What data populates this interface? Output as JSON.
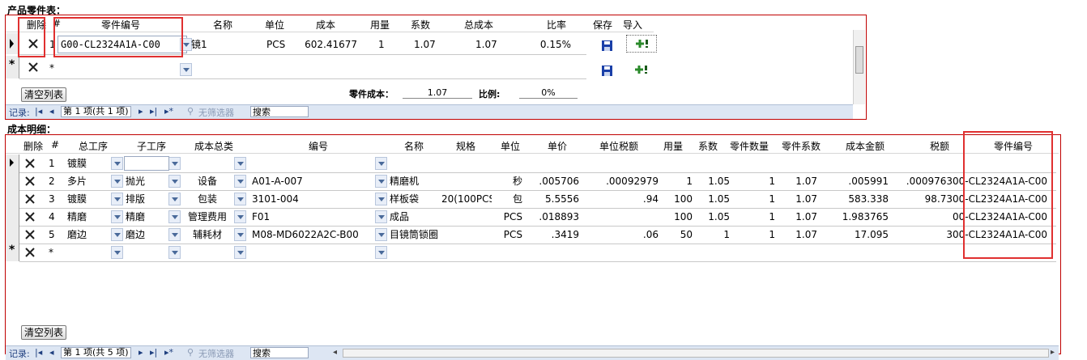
{
  "parts": {
    "title": "产品零件表：",
    "headers": {
      "delete": "删除",
      "index": "#",
      "part_no": "零件编号",
      "name": "名称",
      "unit": "单位",
      "cost": "成本",
      "qty": "用量",
      "coef": "系数",
      "total": "总成本",
      "ratio": "比率",
      "save": "保存",
      "import": "导入"
    },
    "rows": [
      {
        "index": "1",
        "part_no": "G00-CL2324A1A-C00",
        "name": "镜1",
        "unit": "PCS",
        "cost": "602.41677",
        "qty": "1",
        "coef": "1.07",
        "total": "1.07",
        "ratio": "0.15%"
      }
    ],
    "new_row_marker": "*",
    "clear_button": "清空列表",
    "summary": {
      "cost_label": "零件成本：",
      "cost_value": "1.07",
      "ratio_label": "比例:",
      "ratio_value": "0%"
    },
    "nav": {
      "record_label": "记录:",
      "position": "第 1 项(共 1 项)",
      "filter": "无筛选器",
      "search_placeholder": "搜索"
    }
  },
  "costs": {
    "title": "成本明细：",
    "headers": {
      "delete": "删除",
      "index": "#",
      "main_proc": "总工序",
      "sub_proc": "子工序",
      "category": "成本总类",
      "code": "编号",
      "name": "名称",
      "spec": "规格",
      "unit": "单位",
      "price": "单价",
      "unit_tax": "单位税额",
      "qty": "用量",
      "coef": "系数",
      "part_qty": "零件数量",
      "part_coef": "零件系数",
      "amount": "成本金额",
      "tax": "税额",
      "part_no": "零件编号"
    },
    "rows": [
      {
        "index": "1",
        "main_proc": "镀膜",
        "sub_proc": "",
        "category": "",
        "code": "",
        "name": "",
        "spec": "",
        "unit": "",
        "price": "",
        "unit_tax": "",
        "qty": "",
        "coef": "",
        "part_qty": "",
        "part_coef": "",
        "amount": "",
        "tax": "",
        "part_no": ""
      },
      {
        "index": "2",
        "main_proc": "多片",
        "sub_proc": "抛光",
        "category": "设备",
        "code": "A01-A-007",
        "name": "精磨机",
        "spec": "",
        "unit": "秒",
        "price": ".005706",
        "unit_tax": ".00092979",
        "qty": "1",
        "coef": "1.05",
        "part_qty": "1",
        "part_coef": "1.07",
        "amount": ".005991",
        ".tax": "",
        "tax": ".000976300-CL2324A1A-C00",
        "part_no": ""
      },
      {
        "index": "3",
        "main_proc": "镀膜",
        "sub_proc": "排版",
        "category": "包装",
        "code": "3101-004",
        "name": "样板袋",
        "spec": "20(100PCS",
        "unit": "包",
        "price": "5.5556",
        "unit_tax": ".94",
        "qty": "100",
        "coef": "1.05",
        "part_qty": "1",
        "part_coef": "1.07",
        "amount": "583.338",
        "tax": "98.7300-CL2324A1A-C00",
        "part_no": ""
      },
      {
        "index": "4",
        "main_proc": "精磨",
        "sub_proc": "精磨",
        "category": "管理费用",
        "code": "F01",
        "name": "成品",
        "spec": "",
        "unit": "PCS",
        "price": ".018893",
        "unit_tax": "",
        "qty": "100",
        "coef": "1.05",
        "part_qty": "1",
        "part_coef": "1.07",
        "amount": "1.983765",
        "tax": "00-CL2324A1A-C00",
        "part_no": ""
      },
      {
        "index": "5",
        "main_proc": "磨边",
        "sub_proc": "磨边",
        "category": "辅耗材",
        "code": "M08-MD6022A2C-B00",
        "name": "目镜筒锁圈",
        "spec": "",
        "unit": "PCS",
        "price": ".3419",
        "unit_tax": ".06",
        "qty": "50",
        "coef": "1",
        "part_qty": "1",
        "part_coef": "1.07",
        "amount": "17.095",
        "tax": "300-CL2324A1A-C00",
        "part_no": ""
      }
    ],
    "new_row_marker": "*",
    "clear_button": "清空列表",
    "nav": {
      "record_label": "记录:",
      "position": "第 1 项(共 5 项)",
      "filter": "无筛选器",
      "search_placeholder": "搜索"
    }
  },
  "icons": {
    "delete": "close-icon",
    "save": "floppy-disk-icon",
    "import": "add-import-icon",
    "dropdown": "chevron-down-icon",
    "record_pointer": "triangle-right-icon"
  },
  "colors": {
    "panel_border": "#c00000",
    "highlight_box": "#e03030",
    "nav_bg": "#dde6f3"
  }
}
